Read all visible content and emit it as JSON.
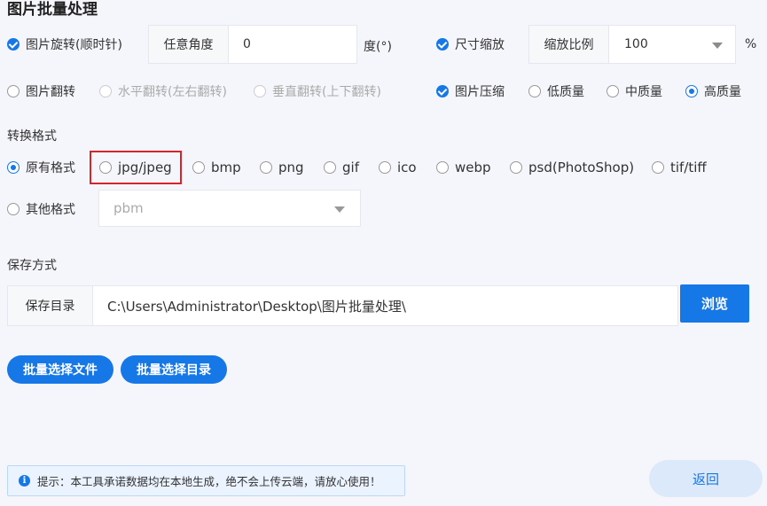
{
  "title": "图片批量处理",
  "rotate": {
    "label": "图片旋转(顺时针)",
    "angle_label": "任意角度",
    "angle_value": "0",
    "unit": "度(°)"
  },
  "resize": {
    "label": "尺寸缩放",
    "ratio_label": "缩放比例",
    "ratio_value": "100",
    "unit": "%"
  },
  "flip": {
    "label": "图片翻转",
    "horizontal": "水平翻转(左右翻转)",
    "vertical": "垂直翻转(上下翻转)"
  },
  "compress": {
    "label": "图片压缩",
    "low": "低质量",
    "mid": "中质量",
    "high": "高质量"
  },
  "convert": {
    "section": "转换格式",
    "formats": [
      "原有格式",
      "jpg/jpeg",
      "bmp",
      "png",
      "gif",
      "ico",
      "webp",
      "psd(PhotoShop)",
      "tif/tiff"
    ],
    "other_label": "其他格式",
    "other_value": "pbm"
  },
  "save": {
    "section": "保存方式",
    "dir_label": "保存目录",
    "dir_value": "C:\\Users\\Administrator\\Desktop\\图片批量处理\\",
    "browse": "浏览"
  },
  "actions": {
    "select_files": "批量选择文件",
    "select_dir": "批量选择目录"
  },
  "tip": "提示：本工具承诺数据均在本地生成，绝不会上传云端，请放心使用！",
  "back": "返回",
  "colors": {
    "accent": "#1677e6",
    "highlight": "#d8232a"
  }
}
